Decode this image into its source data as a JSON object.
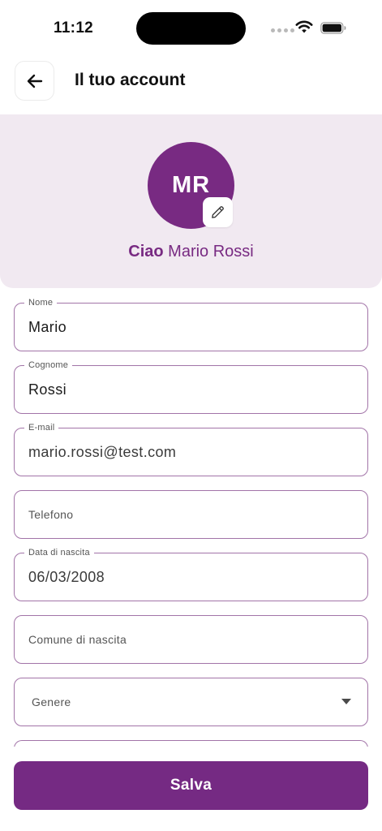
{
  "status_bar": {
    "time": "11:12",
    "icons": [
      "signal-dots-icon",
      "wifi-icon",
      "battery-icon"
    ]
  },
  "header": {
    "back_icon": "arrow-left-icon",
    "title": "Il tuo account"
  },
  "profile": {
    "initials": "MR",
    "edit_icon": "pencil-icon",
    "greeting_prefix": "Ciao",
    "name": "Mario Rossi"
  },
  "form": {
    "nome": {
      "label": "Nome",
      "value": "Mario"
    },
    "cognome": {
      "label": "Cognome",
      "value": "Rossi"
    },
    "email": {
      "label": "E-mail",
      "value": "mario.rossi@test.com"
    },
    "telefono": {
      "placeholder": "Telefono"
    },
    "data_nascita": {
      "label": "Data di nascita",
      "value": "06/03/2008"
    },
    "comune_nascita": {
      "placeholder": "Comune di nascita"
    },
    "genere": {
      "placeholder": "Genere",
      "icon": "dropdown-arrow-icon"
    }
  },
  "actions": {
    "save_label": "Salva"
  },
  "colors": {
    "primary": "#752a83",
    "banner_bg": "#f1e9f1",
    "field_border": "#a274a8"
  }
}
